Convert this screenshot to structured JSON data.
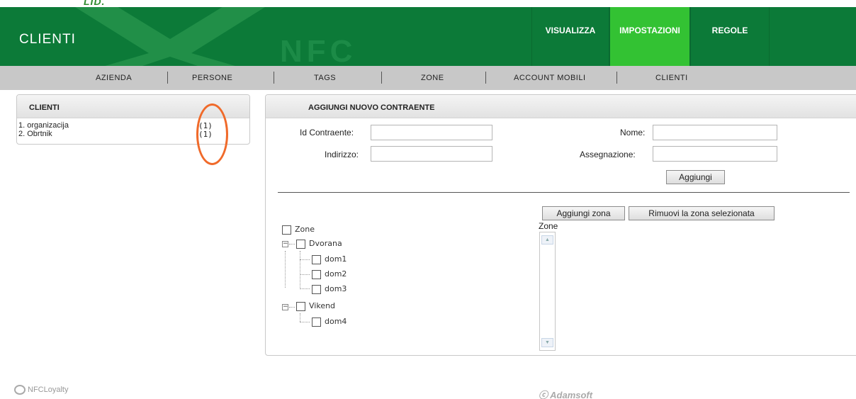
{
  "top_logo_fragment": "LID.",
  "header": {
    "title": "CLIENTI",
    "watermark": "NFC",
    "nav": [
      {
        "label": "VISUALIZZA",
        "active": false
      },
      {
        "label": "IMPOSTAZIONI",
        "active": true
      },
      {
        "label": "REGOLE",
        "active": false
      }
    ]
  },
  "subnav": [
    "AZIENDA",
    "PERSONE",
    "TAGS",
    "ZONE",
    "ACCOUNT MOBILI",
    "CLIENTI"
  ],
  "clients_panel": {
    "title": "CLIENTI",
    "items": [
      {
        "label": "1. organizacija",
        "count": "(1)"
      },
      {
        "label": "2. Obrtnik",
        "count": "(1)"
      }
    ]
  },
  "form_panel": {
    "title": "AGGIUNGI NUOVO CONTRAENTE",
    "fields": {
      "id_contraente": {
        "label": "Id Contraente:",
        "value": ""
      },
      "nome": {
        "label": "Nome:",
        "value": ""
      },
      "indirizzo": {
        "label": "Indirizzo:",
        "value": ""
      },
      "assegnazione": {
        "label": "Assegnazione:",
        "value": ""
      }
    },
    "add_button": "Aggiungi",
    "add_zone_button": "Aggiungi zona",
    "remove_zone_button": "Rimuovi la zona selezionata",
    "zone_list_label": "Zone",
    "tree": {
      "root": "Zone",
      "groups": [
        {
          "label": "Dvorana",
          "children": [
            "dom1",
            "dom2",
            "dom3"
          ]
        },
        {
          "label": "Vikend",
          "children": [
            "dom4"
          ]
        }
      ]
    }
  },
  "footer": {
    "left_brand": "NFCLoyalty",
    "center_brand": "Adamsoft"
  },
  "colors": {
    "header_green": "#0c7a38",
    "active_nav": "#33c233",
    "subnav_gray": "#c8c8c8",
    "annotation_orange": "#f06a2a"
  }
}
